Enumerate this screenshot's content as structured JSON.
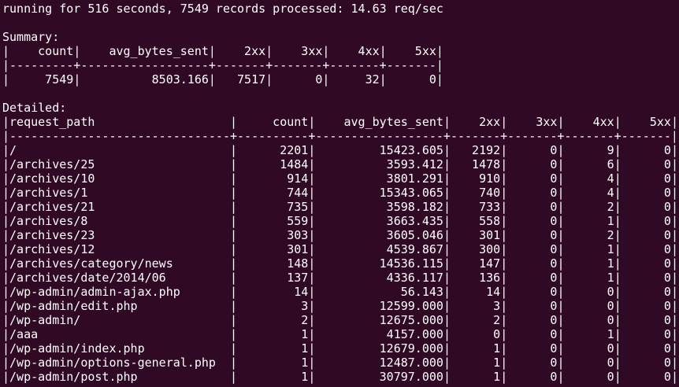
{
  "terminal": {
    "status": "running for 516 seconds, 7549 records processed: 14.63 req/sec",
    "summary_label": "Summary:",
    "detailed_label": "Detailed:",
    "summary": {
      "columns": [
        "count",
        "avg_bytes_sent",
        "2xx",
        "3xx",
        "4xx",
        "5xx"
      ],
      "rows": [
        [
          "7549",
          "8503.166",
          "7517",
          "0",
          "32",
          "0"
        ]
      ]
    },
    "detailed": {
      "columns": [
        "request_path",
        "count",
        "avg_bytes_sent",
        "2xx",
        "3xx",
        "4xx",
        "5xx"
      ],
      "rows": [
        [
          "/",
          "2201",
          "15423.605",
          "2192",
          "0",
          "9",
          "0"
        ],
        [
          "/archives/25",
          "1484",
          "3593.412",
          "1478",
          "0",
          "6",
          "0"
        ],
        [
          "/archives/10",
          "914",
          "3801.291",
          "910",
          "0",
          "4",
          "0"
        ],
        [
          "/archives/1",
          "744",
          "15343.065",
          "740",
          "0",
          "4",
          "0"
        ],
        [
          "/archives/21",
          "735",
          "3598.182",
          "733",
          "0",
          "2",
          "0"
        ],
        [
          "/archives/8",
          "559",
          "3663.435",
          "558",
          "0",
          "1",
          "0"
        ],
        [
          "/archives/23",
          "303",
          "3605.046",
          "301",
          "0",
          "2",
          "0"
        ],
        [
          "/archives/12",
          "301",
          "4539.867",
          "300",
          "0",
          "1",
          "0"
        ],
        [
          "/archives/category/news",
          "148",
          "14536.115",
          "147",
          "0",
          "1",
          "0"
        ],
        [
          "/archives/date/2014/06",
          "137",
          "4336.117",
          "136",
          "0",
          "1",
          "0"
        ],
        [
          "/wp-admin/admin-ajax.php",
          "14",
          "56.143",
          "14",
          "0",
          "0",
          "0"
        ],
        [
          "/wp-admin/edit.php",
          "3",
          "12599.000",
          "3",
          "0",
          "0",
          "0"
        ],
        [
          "/wp-admin/",
          "2",
          "12675.000",
          "2",
          "0",
          "0",
          "0"
        ],
        [
          "/aaa",
          "1",
          "4157.000",
          "0",
          "0",
          "1",
          "0"
        ],
        [
          "/wp-admin/index.php",
          "1",
          "12679.000",
          "1",
          "0",
          "0",
          "0"
        ],
        [
          "/wp-admin/options-general.php",
          "1",
          "12487.000",
          "1",
          "0",
          "0",
          "0"
        ],
        [
          "/wp-admin/post.php",
          "1",
          "30797.000",
          "1",
          "0",
          "0",
          "0"
        ]
      ]
    }
  }
}
